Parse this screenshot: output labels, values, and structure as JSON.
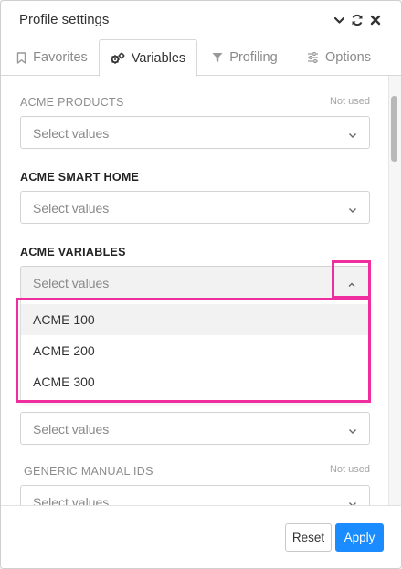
{
  "header": {
    "title": "Profile settings",
    "icons": [
      "chevron-down-icon",
      "refresh-icon",
      "close-icon"
    ]
  },
  "tabs": [
    {
      "label": "Favorites",
      "icon": "bookmark-icon",
      "active": false
    },
    {
      "label": "Variables",
      "icon": "gears-icon",
      "active": true
    },
    {
      "label": "Profiling",
      "icon": "filter-icon",
      "active": false
    },
    {
      "label": "Options",
      "icon": "sliders-icon",
      "active": false
    }
  ],
  "fields": [
    {
      "label": "ACME PRODUCTS",
      "status": "Not used",
      "placeholder": "Select values"
    },
    {
      "label": "ACME SMART HOME",
      "placeholder": "Select values"
    },
    {
      "label": "ACME VARIABLES",
      "placeholder": "Select values",
      "open": true
    },
    {
      "placeholder": "Select values"
    },
    {
      "label": "GENERIC MANUAL IDS",
      "status": "Not used",
      "placeholder": "Select values"
    }
  ],
  "dropdown_options": [
    "ACME 100",
    "ACME 200",
    "ACME 300"
  ],
  "footer": {
    "reset_label": "Reset",
    "apply_label": "Apply"
  },
  "colors": {
    "highlight": "#ee2e9f",
    "apply_button": "#1a8cff"
  }
}
